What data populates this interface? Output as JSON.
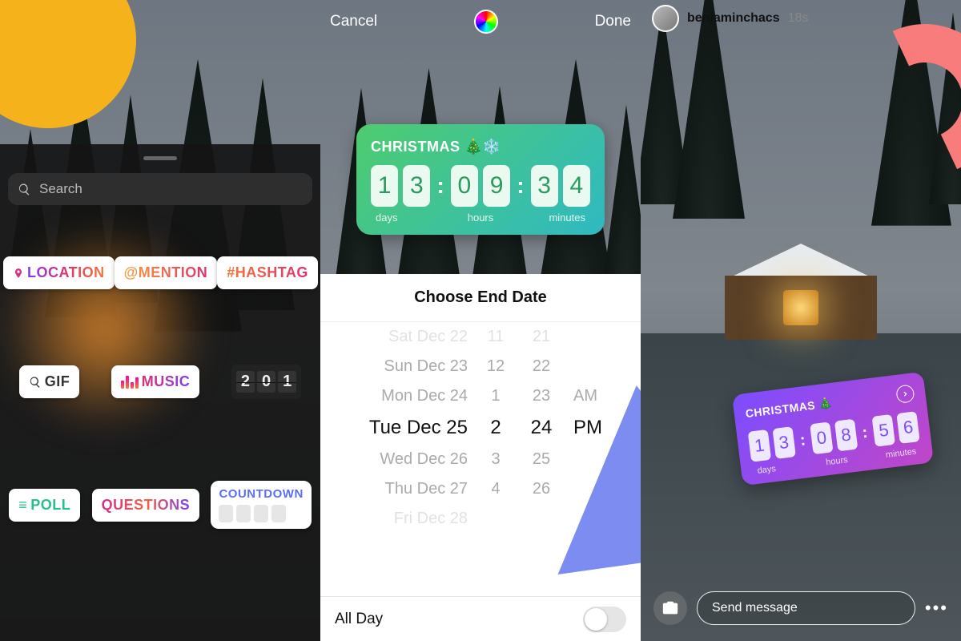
{
  "decor": {
    "sun_color": "#f6b21b",
    "ring_color": "#f97c7c",
    "triangle_color": "#7c8cf0"
  },
  "panel1": {
    "search_placeholder": "Search",
    "stickers": {
      "location": "LOCATION",
      "mention": "@MENTION",
      "hashtag": "#HASHTAG",
      "gif": "GIF",
      "music": "MUSIC",
      "flipclock": [
        "2",
        "0",
        "1"
      ],
      "poll": "POLL",
      "questions": "QUESTIONS",
      "countdown": "COUNTDOWN"
    }
  },
  "panel2": {
    "cancel": "Cancel",
    "done": "Done",
    "countdown": {
      "title": "CHRISTMAS 🎄❄️",
      "digits": [
        "1",
        "3",
        "0",
        "9",
        "3",
        "4"
      ],
      "labels": {
        "days": "days",
        "hours": "hours",
        "minutes": "minutes"
      }
    },
    "sheet_title": "Choose End Date",
    "picker": {
      "rows": [
        {
          "date": "Sat Dec 22",
          "h": "11",
          "m": "21"
        },
        {
          "date": "Sun Dec 23",
          "h": "12",
          "m": "22"
        },
        {
          "date": "Mon Dec 24",
          "h": "1",
          "m": "23",
          "ampm": "AM"
        },
        {
          "date": "Tue Dec 25",
          "h": "2",
          "m": "24",
          "ampm": "PM",
          "selected": true
        },
        {
          "date": "Wed Dec 26",
          "h": "3",
          "m": "25"
        },
        {
          "date": "Thu Dec 27",
          "h": "4",
          "m": "26"
        },
        {
          "date": "Fri Dec 28",
          "h": "",
          "m": ""
        }
      ]
    },
    "all_day_label": "All Day",
    "all_day_on": false
  },
  "panel3": {
    "username": "benjaminchacs",
    "timestamp": "18s",
    "countdown": {
      "title": "CHRISTMAS 🎄",
      "digits": [
        "1",
        "3",
        "0",
        "8",
        "5",
        "6"
      ],
      "labels": {
        "days": "days",
        "hours": "hours",
        "minutes": "minutes"
      }
    },
    "send_placeholder": "Send message"
  }
}
